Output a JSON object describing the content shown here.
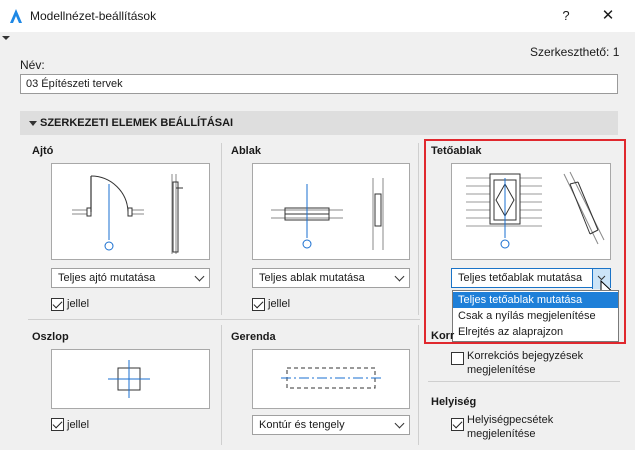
{
  "window": {
    "title": "Modellnézet-beállítások",
    "help": "?",
    "close": "✕"
  },
  "editable_label": "Szerkeszthető: 1",
  "name": {
    "label": "Név:",
    "value": "03 Építészeti tervek"
  },
  "section": {
    "title": "SZERKEZETI ELEMEK BEÁLLÍTÁSAI"
  },
  "door": {
    "title": "Ajtó",
    "select": "Teljes ajtó mutatása",
    "checkbox": "jellel",
    "checked": true
  },
  "window_panel": {
    "title": "Ablak",
    "select": "Teljes ablak mutatása",
    "checkbox": "jellel",
    "checked": true
  },
  "skylight": {
    "title": "Tetőablak",
    "select": "Teljes tetőablak mutatása",
    "options": [
      "Teljes tetőablak mutatása",
      "Csak a nyílás megjelenítése",
      "Elrejtés az alaprajzon"
    ],
    "selected_index": 0
  },
  "column": {
    "title": "Oszlop",
    "checkbox": "jellel",
    "checked": true
  },
  "beam": {
    "title": "Gerenda",
    "select": "Kontúr és tengely"
  },
  "correction": {
    "title_partial": "Korr",
    "checkbox_line1": "Korrekciós bejegyzések",
    "checkbox_line2": "megjelenítése",
    "checked": false
  },
  "zone": {
    "title": "Helyiség",
    "checkbox_line1": "Helyiségpecsétek",
    "checkbox_line2": "megjelenítése",
    "checked": true
  },
  "colors": {
    "accent": "#e0282e",
    "selection": "#1e7fd8",
    "preview_line": "#1a6fd0"
  }
}
